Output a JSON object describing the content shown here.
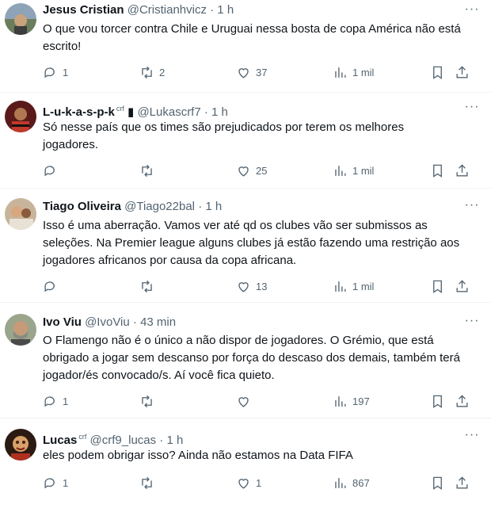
{
  "tweets": [
    {
      "name": "Jesus Cristian",
      "handle": "@Cristianhvicz",
      "time": "· 1 h",
      "badge": "",
      "text": "O que vou torcer contra Chile e Uruguai nessa bosta de copa América não está escrito!",
      "replies": "1",
      "retweets": "2",
      "likes": "37",
      "views": "1 mil"
    },
    {
      "name": "L-u-k-a-s-p-k",
      "handle": "@Lukascrf7",
      "time": "· 1 h",
      "badge": "crf",
      "text": "Só nesse país que os times são prejudicados por terem  os melhores jogadores.",
      "replies": "",
      "retweets": "",
      "likes": "25",
      "views": "1 mil"
    },
    {
      "name": "Tiago Oliveira",
      "handle": "@Tiago22bal",
      "time": "· 1 h",
      "badge": "",
      "text": "Isso é uma aberração. Vamos ver até qd os clubes vão ser submissos as seleções. Na Premier league alguns clubes já estão fazendo uma restrição aos jogadores africanos por causa da copa africana.",
      "replies": "",
      "retweets": "",
      "likes": "13",
      "views": "1 mil"
    },
    {
      "name": "Ivo Viu",
      "handle": "@IvoViu",
      "time": "· 43 min",
      "badge": "",
      "text": "O Flamengo não é o único a não dispor de jogadores. O Grémio, que está obrigado a jogar sem descanso por força do descaso dos demais, também terá jogador/és convocado/s. Aí você fica quieto.",
      "replies": "1",
      "retweets": "",
      "likes": "",
      "views": "197"
    },
    {
      "name": "Lucas",
      "handle": "@crf9_lucas",
      "time": "· 1 h",
      "badge": "crf",
      "text": "eles podem obrigar isso? Ainda não estamos na Data FIFA",
      "replies": "1",
      "retweets": "",
      "likes": "1",
      "views": "867"
    }
  ],
  "icons": {
    "reply": "reply-icon",
    "retweet": "retweet-icon",
    "like": "heart-icon",
    "views": "views-icon",
    "bookmark": "bookmark-icon",
    "share": "share-icon",
    "more": "more-icon"
  },
  "colors": {
    "text": "#0f1419",
    "secondary": "#536471",
    "divider": "#eff3f4"
  }
}
